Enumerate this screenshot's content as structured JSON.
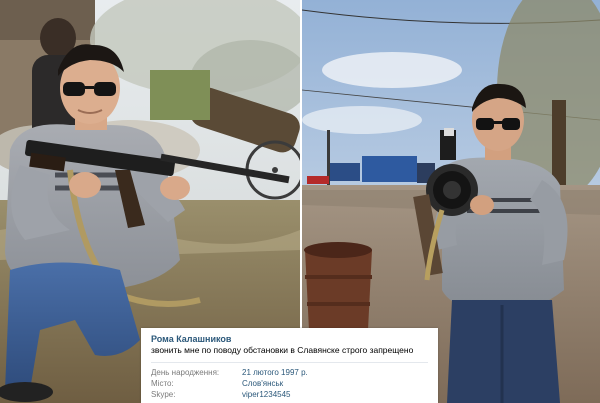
{
  "profile": {
    "name": "Рома Калашников",
    "status": "звонить мне по поводу обстановки в Славянске строго запрещено",
    "fields": [
      {
        "label": "День народження:",
        "value": "21 лютого 1997 р."
      },
      {
        "label": "Місто:",
        "value": "Слов'янськ"
      },
      {
        "label": "Skype:",
        "value": "viper1234545"
      }
    ]
  },
  "colors": {
    "profile_name": "#2b587a",
    "link_value": "#2b587a",
    "label_gray": "#7b7b7b"
  }
}
